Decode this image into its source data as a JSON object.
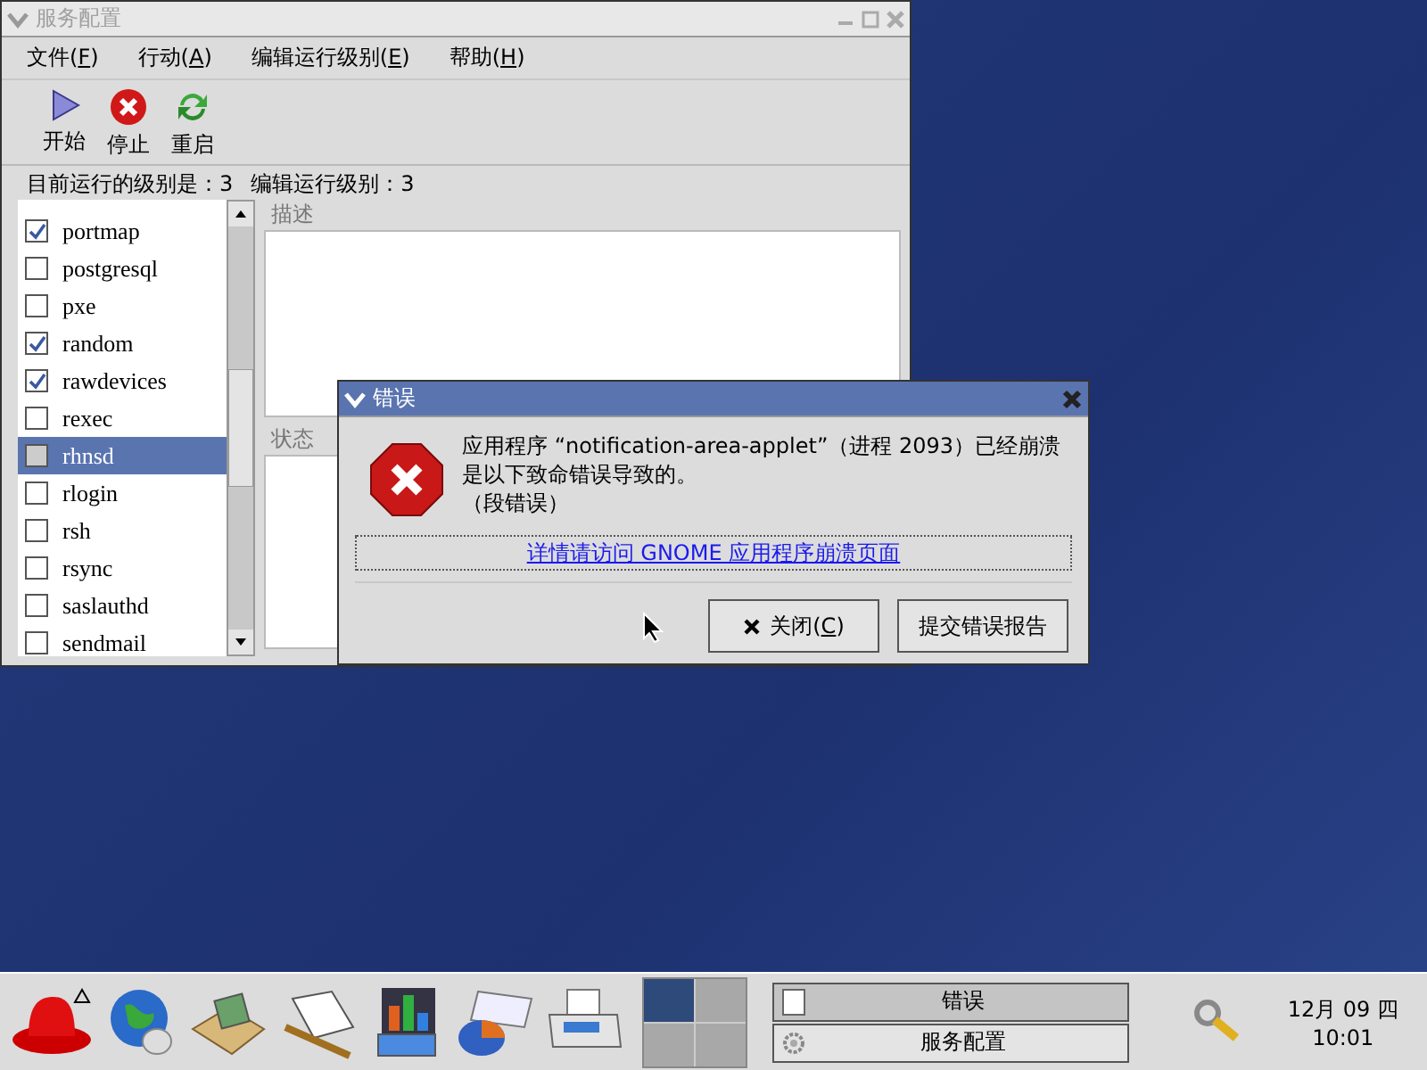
{
  "main_window": {
    "title": "服务配置",
    "menu": [
      {
        "before": "文件(",
        "key": "F",
        "after": ")"
      },
      {
        "before": "行动(",
        "key": "A",
        "after": ")"
      },
      {
        "before": "编辑运行级别(",
        "key": "E",
        "after": ")"
      },
      {
        "before": "帮助(",
        "key": "H",
        "after": ")"
      }
    ],
    "toolbar": [
      {
        "label": "开始",
        "kind": "start"
      },
      {
        "label": "停止",
        "kind": "stop"
      },
      {
        "label": "重启",
        "kind": "restart"
      }
    ],
    "runlevel_current": "目前运行的级别是：3",
    "runlevel_editing": "编辑运行级别：3",
    "services": [
      {
        "name": "portmap",
        "checked": true,
        "selected": false
      },
      {
        "name": "postgresql",
        "checked": false,
        "selected": false
      },
      {
        "name": "pxe",
        "checked": false,
        "selected": false
      },
      {
        "name": "random",
        "checked": true,
        "selected": false
      },
      {
        "name": "rawdevices",
        "checked": true,
        "selected": false
      },
      {
        "name": "rexec",
        "checked": false,
        "selected": false
      },
      {
        "name": "rhnsd",
        "checked": false,
        "selected": true
      },
      {
        "name": "rlogin",
        "checked": false,
        "selected": false
      },
      {
        "name": "rsh",
        "checked": false,
        "selected": false
      },
      {
        "name": "rsync",
        "checked": false,
        "selected": false
      },
      {
        "name": "saslauthd",
        "checked": false,
        "selected": false
      },
      {
        "name": "sendmail",
        "checked": false,
        "selected": false
      }
    ],
    "description_label": "描述",
    "status_label": "状态"
  },
  "dialog": {
    "title": "错误",
    "message_lines": [
      "应用程序 “notification-area-applet”（进程 2093）已经崩溃",
      "是以下致命错误导致的。",
      "（段错误）"
    ],
    "link": "详情请访问 GNOME 应用程序崩溃页面",
    "buttons": [
      {
        "kind": "close",
        "before": "关闭(",
        "key": "C",
        "after": ")"
      },
      {
        "kind": "plain",
        "before": "提交错误报告"
      }
    ]
  },
  "taskbar": {
    "workspaces": [
      {
        "selected": true
      },
      {
        "selected": false
      },
      {
        "selected": false
      },
      {
        "selected": false
      }
    ],
    "tasks": [
      {
        "label": "错误",
        "kind": "dialog",
        "selected": true
      },
      {
        "label": "服务配置",
        "kind": "gear",
        "selected": false
      }
    ],
    "clock_date": "12月 09 四",
    "clock_time": "10:01"
  }
}
